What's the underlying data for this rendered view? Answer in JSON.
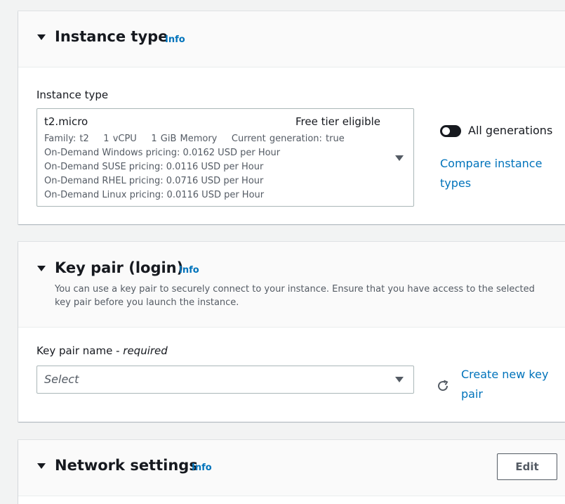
{
  "instance_type": {
    "title": "Instance type",
    "info": "Info",
    "field_label": "Instance type",
    "selected": {
      "name": "t2.micro",
      "tag": "Free tier eligible",
      "details": [
        "Family: t2    1 vCPU    1 GiB Memory    Current generation: true",
        "On-Demand Windows pricing: 0.0162 USD per Hour",
        "On-Demand SUSE pricing: 0.0116 USD per Hour",
        "On-Demand RHEL pricing: 0.0716 USD per Hour",
        "On-Demand Linux pricing: 0.0116 USD per Hour"
      ]
    },
    "toggle_label": "All generations",
    "toggle_on": true,
    "compare_link_line1": "Compare instance",
    "compare_link_line2": "types"
  },
  "key_pair": {
    "title": "Key pair (login)",
    "info": "Info",
    "description_line1": "You can use a key pair to securely connect to your instance. Ensure that you have access to the selected",
    "description_line2": "key pair before you launch the instance.",
    "field_label": "Key pair name - ",
    "field_required": "required",
    "placeholder": "Select",
    "create_link_line1": "Create new key",
    "create_link_line2": "pair"
  },
  "network": {
    "title": "Network settings",
    "info": "Info",
    "edit_label": "Edit"
  },
  "colors": {
    "link": "#0073bb",
    "text": "#16191f",
    "muted": "#545b64",
    "background": "#f2f3f3"
  }
}
